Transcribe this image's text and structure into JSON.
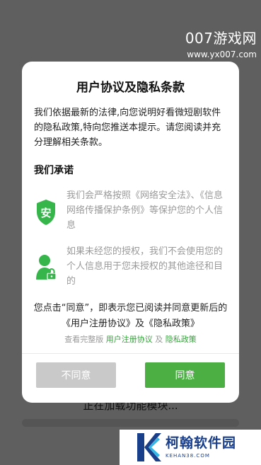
{
  "watermark_top": {
    "title": "007游戏网",
    "url": "www.yx007.com"
  },
  "background": {
    "loading_text": "正在加载功能模块..."
  },
  "dialog": {
    "title": "用户协议及隐私条款",
    "intro": "我们依据最新的法律,向您说明好看微短剧软件的隐私政策,特向您推送本提示。请您阅读并充分理解相关条款。",
    "promise_title": "我们承诺",
    "promises": [
      {
        "icon": "shield-icon",
        "icon_char": "安",
        "text": "我们会严格按照《网络安全法》、《信息网络传播保护条例》等保护您的个人信息"
      },
      {
        "icon": "user-lock-icon",
        "text": "如果未经您的授权，我们不会使用您的个人信息用于您未授权的其他途径和目的"
      }
    ],
    "consent": "您点击“同意”，即表示您已阅读并同意更新后的《用户注册协议》及《隐私政策》",
    "links": {
      "prefix": "查看完整版",
      "user_agreement": "用户注册协议",
      "and": "及",
      "privacy_policy": "隐私政策"
    },
    "disagree_label": "不同意",
    "agree_label": "同意"
  },
  "watermark_bottom": {
    "name": "柯翰软件园",
    "url": "KEHAN38.COM"
  },
  "colors": {
    "accent_green": "#4caf44",
    "link_green": "#37a13d",
    "disabled_gray": "#c9c9c9",
    "overlay": "#5f5f5f",
    "brand_blue": "#1a3f8a"
  }
}
